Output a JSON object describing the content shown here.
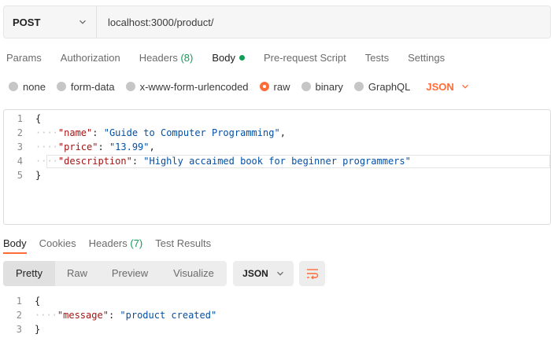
{
  "request": {
    "method": "POST",
    "url": "localhost:3000/product/"
  },
  "request_tabs": [
    {
      "label": "Params"
    },
    {
      "label": "Authorization"
    },
    {
      "label": "Headers",
      "count": "(8)"
    },
    {
      "label": "Body"
    },
    {
      "label": "Pre-request Script"
    },
    {
      "label": "Tests"
    },
    {
      "label": "Settings"
    }
  ],
  "body_types": [
    {
      "label": "none"
    },
    {
      "label": "form-data"
    },
    {
      "label": "x-www-form-urlencoded"
    },
    {
      "label": "raw"
    },
    {
      "label": "binary"
    },
    {
      "label": "GraphQL"
    }
  ],
  "body_language": "JSON",
  "request_body": {
    "line_numbers": [
      "1",
      "2",
      "3",
      "4",
      "5"
    ],
    "open": "{",
    "close": "}",
    "indent": "····",
    "fields": [
      {
        "key": "\"name\"",
        "value": "\"Guide to Computer Programming\"",
        "trail": ","
      },
      {
        "key": "\"price\"",
        "value": "\"13.99\"",
        "trail": ","
      },
      {
        "key": "\"description\"",
        "value": "\"Highly accaimed book for beginner programmers\"",
        "trail": ""
      }
    ]
  },
  "response_tabs": [
    {
      "label": "Body"
    },
    {
      "label": "Cookies"
    },
    {
      "label": "Headers",
      "count": "(7)"
    },
    {
      "label": "Test Results"
    }
  ],
  "view_modes": [
    {
      "label": "Pretty"
    },
    {
      "label": "Raw"
    },
    {
      "label": "Preview"
    },
    {
      "label": "Visualize"
    }
  ],
  "response_format": "JSON",
  "response_body": {
    "line_numbers": [
      "1",
      "2",
      "3"
    ],
    "open": "{",
    "close": "}",
    "indent": "····",
    "key": "\"message\"",
    "value": "\"product created\""
  },
  "colors": {
    "accent": "#ff6c37",
    "status_green": "#0f9d58",
    "json_key": "#a31515",
    "json_string": "#0451a5"
  },
  "icons": {
    "method_dropdown": "chevron-down-icon",
    "language_dropdown": "chevron-down-icon",
    "format_dropdown": "chevron-down-icon",
    "wrap_lines": "wrap-lines-icon",
    "body_status": "dot-indicator-icon"
  }
}
